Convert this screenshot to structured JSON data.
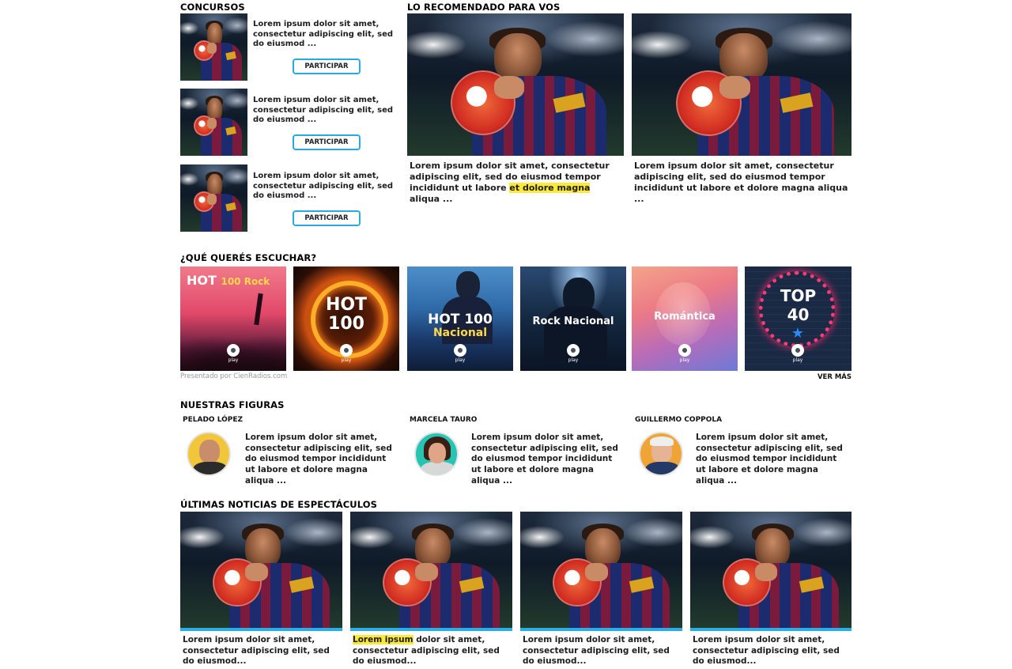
{
  "colors": {
    "accent": "#29aee8",
    "highlight": "#fde93a",
    "button_border": "#2aa9e0"
  },
  "concursos": {
    "title": "CONCURSOS",
    "items": [
      {
        "text": "Lorem ipsum dolor sit amet, consectetur adipiscing elit, sed do eiusmod ...",
        "button": "PARTICIPAR"
      },
      {
        "text": "Lorem ipsum dolor sit amet, consectetur adipiscing elit, sed do eiusmod ...",
        "button": "PARTICIPAR"
      },
      {
        "text": "Lorem ipsum dolor sit amet, consectetur adipiscing elit, sed do eiusmod ...",
        "button": "PARTICIPAR"
      }
    ]
  },
  "recomendado": {
    "title": "LO RECOMENDADO PARA VOS",
    "items": [
      {
        "text_before": "Lorem ipsum dolor sit amet, consectetur adipiscing elit, sed do eiusmod tempor incididunt ut labore ",
        "text_highlight": "et dolore magna",
        "text_after": " aliqua ..."
      },
      {
        "text_before": "Lorem ipsum dolor sit amet, consectetur adipiscing elit, sed do eiusmod tempor incididunt ut labore et dolore magna aliqua ...",
        "text_highlight": "",
        "text_after": ""
      }
    ]
  },
  "escuchar": {
    "title": "¿QUÉ QUERÉS ESCUCHAR?",
    "credit": "Presentado por CienRadios.com",
    "more": "VER MÁS",
    "play_word": "play",
    "tiles": [
      {
        "line1": "HOT",
        "line1b": "100 Rock",
        "line2": ""
      },
      {
        "line1": "HOT",
        "line1b": "",
        "line2": "100"
      },
      {
        "line1": "HOT 100",
        "line1b": "",
        "line2": "Nacional"
      },
      {
        "line1": "Rock Nacional",
        "line1b": "",
        "line2": ""
      },
      {
        "line1": "Romántica",
        "line1b": "",
        "line2": ""
      },
      {
        "line1": "TOP",
        "line1b": "",
        "line2": "40"
      }
    ]
  },
  "figuras": {
    "title": "NUESTRAS FIGURAS",
    "items": [
      {
        "name": "PELADO LÓPEZ",
        "text": "Lorem ipsum dolor sit amet, consectetur adipiscing elit, sed do eiusmod tempor incididunt ut labore et dolore magna aliqua ..."
      },
      {
        "name": "MARCELA TAURO",
        "text": "Lorem ipsum dolor sit amet, consectetur adipiscing elit, sed do eiusmod tempor incididunt ut labore et dolore magna aliqua ..."
      },
      {
        "name": "GUILLERMO COPPOLA",
        "text": "Lorem ipsum dolor sit amet, consectetur adipiscing elit, sed do eiusmod tempor incididunt ut labore et dolore magna aliqua ..."
      }
    ]
  },
  "espectaculos": {
    "title": "ÚLTIMAS NOTICIAS DE ESPECTÁCULOS",
    "items": [
      {
        "highlight": "",
        "text": "Lorem ipsum dolor sit amet, consectetur adipiscing elit, sed do eiusmod..."
      },
      {
        "highlight": "Lorem ipsum",
        "text": " dolor sit amet, consectetur adipiscing elit, sed do eiusmod..."
      },
      {
        "highlight": "",
        "text": "Lorem ipsum dolor sit amet, consectetur adipiscing elit, sed do eiusmod..."
      },
      {
        "highlight": "",
        "text": "Lorem ipsum dolor sit amet, consectetur adipiscing elit, sed do eiusmod..."
      }
    ]
  }
}
